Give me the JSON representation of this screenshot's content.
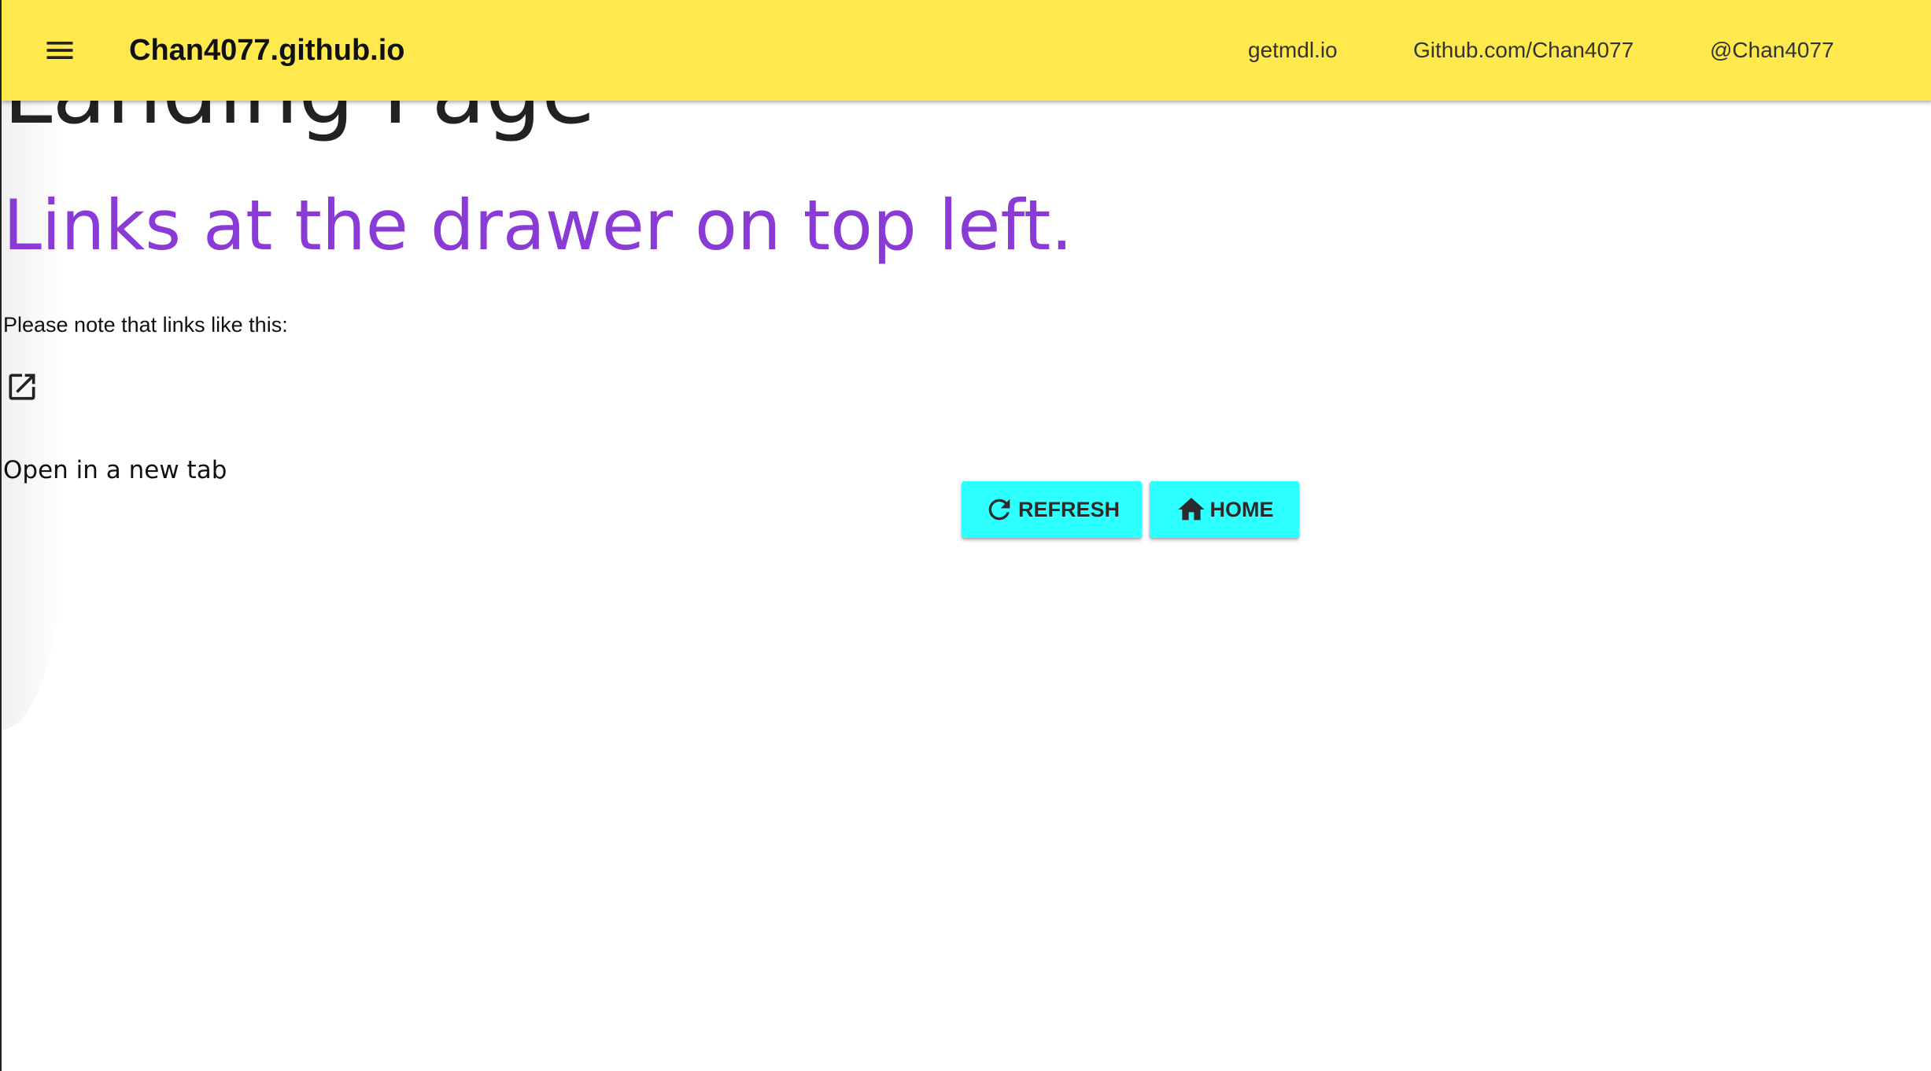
{
  "header": {
    "title": "Chan4077.github.io",
    "nav": [
      {
        "label": "getmdl.io"
      },
      {
        "label": "Github.com/Chan4077"
      },
      {
        "label": "@Chan4077"
      }
    ],
    "menu_icon": "hamburger-menu-icon",
    "background_color": "#ffe94d"
  },
  "main": {
    "heading": "Landing Page",
    "subheading": "Links at the drawer on top left.",
    "subheading_color": "#8a3bd6",
    "note": "Please note that links like this:",
    "external_link_icon": "open-in-new-icon",
    "open_text": "Open in a new tab"
  },
  "buttons": {
    "refresh": {
      "label": "Refresh",
      "icon": "refresh-icon"
    },
    "home": {
      "label": "Home",
      "icon": "home-icon"
    },
    "color": "#2effff"
  }
}
